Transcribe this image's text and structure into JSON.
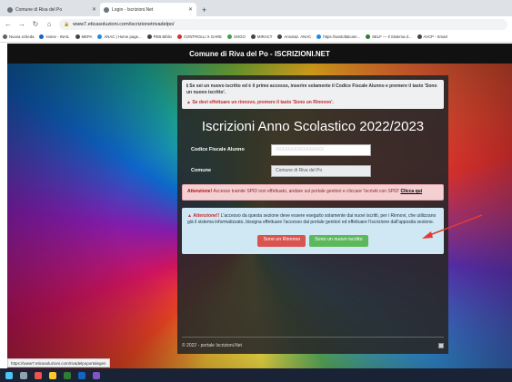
{
  "browser": {
    "tabs": [
      {
        "label": "Comune di Riva del Po",
        "active": false
      },
      {
        "label": "Login - Iscrizioni.Net",
        "active": true
      }
    ],
    "new_tab": "+",
    "url": "www7.eticasoluzioni.com/iscrizionetrivadelpo/",
    "bookmarks": [
      {
        "label": "Nuova scheda",
        "color": "#5f6368"
      },
      {
        "label": "Home - INAIL",
        "color": "#1565c0"
      },
      {
        "label": "MEPA",
        "color": "#444"
      },
      {
        "label": "ANAC | Home page...",
        "color": "#1e88e5"
      },
      {
        "label": "PEB Biblio",
        "color": "#444"
      },
      {
        "label": "CONTROLLI X GARE",
        "color": "#d32f2f"
      },
      {
        "label": "SOGO",
        "color": "#43a047"
      },
      {
        "label": "MIRACT",
        "color": "#444"
      },
      {
        "label": "Annotaz. ANAC",
        "color": "#444"
      },
      {
        "label": "https://santofaticam...",
        "color": "#1e88e5"
      },
      {
        "label": "SELF — Il Sistema d...",
        "color": "#2e7d32"
      },
      {
        "label": "AVCP - Smart",
        "color": "#444"
      }
    ],
    "status_url": "https://www7.eticasoluzioni.com/rivadelpoportalegen"
  },
  "page": {
    "header": "Comune di Riva del Po - ISCRIZIONI.NET",
    "info_line1": "Se sei un nuovo iscritto ed è il primo accesso, inserire solamente il Codice Fiscale Alunno e premere il tasto 'Sono un nuovo iscritto'.",
    "info_line2": "Se devi effettuare un rinnovo, premere il tasto 'Sono un Rinnovo'.",
    "title": "Iscrizioni Anno Scolastico 2022/2023",
    "fields": {
      "codice_label": "Codice Fiscale Alunno",
      "codice_value": "XXXXXXXXXXXXXXXX",
      "comune_label": "Comune",
      "comune_value": "Comune di Riva del Po"
    },
    "spid": {
      "strong": "Attenzione!",
      "text": "Accesso tramite SPID non effettuato, andare sul portale genitori e cliccare 'Iscriviti con SPID'",
      "link": "Clicca qui"
    },
    "notice": {
      "strong": "Attenzione!!",
      "text": "L'accesso da questa sezione deve essere eseguito solamente dai nuovi iscritti, per i Rinnovi, che utilizzano già il sistema informatizzato, bisogna effettuare l'accesso dal portale genitori ed effettuare l'iscrizione dall'apposita sezione."
    },
    "buttons": {
      "rinnovo": "Sono un Rinnovo",
      "nuovo": "Sono un nuovo iscritto"
    },
    "footer": "© 2022 - portale Iscrizioni.Net"
  },
  "colors": {
    "red_button": "#d9534f",
    "green_button": "#5cb85c",
    "arrow": "#e53935"
  }
}
